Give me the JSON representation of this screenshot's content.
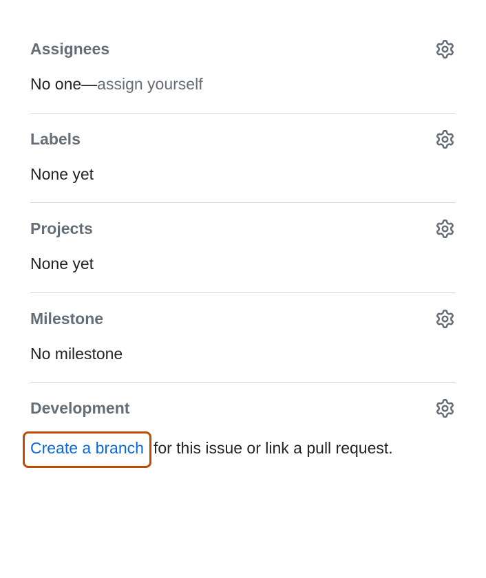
{
  "assignees": {
    "title": "Assignees",
    "no_one_text": "No one—",
    "assign_yourself": "assign yourself"
  },
  "labels": {
    "title": "Labels",
    "body": "None yet"
  },
  "projects": {
    "title": "Projects",
    "body": "None yet"
  },
  "milestone": {
    "title": "Milestone",
    "body": "No milestone"
  },
  "development": {
    "title": "Development",
    "create_branch": "Create a branch",
    "rest_text": "for this issue or link a pull request."
  }
}
